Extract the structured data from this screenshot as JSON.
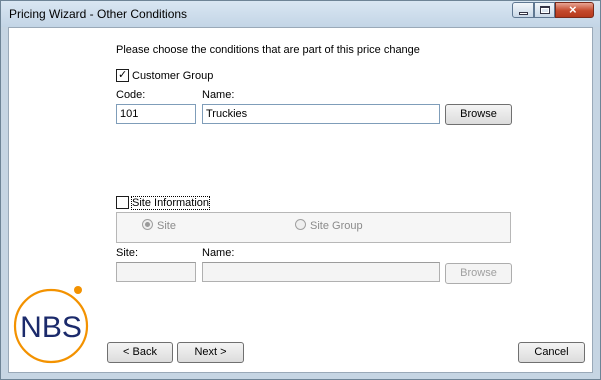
{
  "window": {
    "title": "Pricing Wizard - Other Conditions"
  },
  "intro_text": "Please choose the conditions that are part of this price change",
  "customer_group": {
    "checkbox_label": "Customer Group",
    "checked": true,
    "code_label": "Code:",
    "name_label": "Name:",
    "code_value": "101",
    "name_value": "Truckies",
    "browse_label": "Browse"
  },
  "site_information": {
    "checkbox_label": "Site Information",
    "checked": false,
    "radio_site_label": "Site",
    "radio_site_group_label": "Site Group",
    "site_label": "Site:",
    "name_label": "Name:",
    "site_value": "",
    "name_value": "",
    "browse_label": "Browse"
  },
  "logo": {
    "text": "NBS",
    "accent_color": "#f39200",
    "ring_color": "#f39200",
    "text_color": "#1b2a6b"
  },
  "buttons": {
    "back": "< Back",
    "next": "Next >",
    "cancel": "Cancel"
  }
}
